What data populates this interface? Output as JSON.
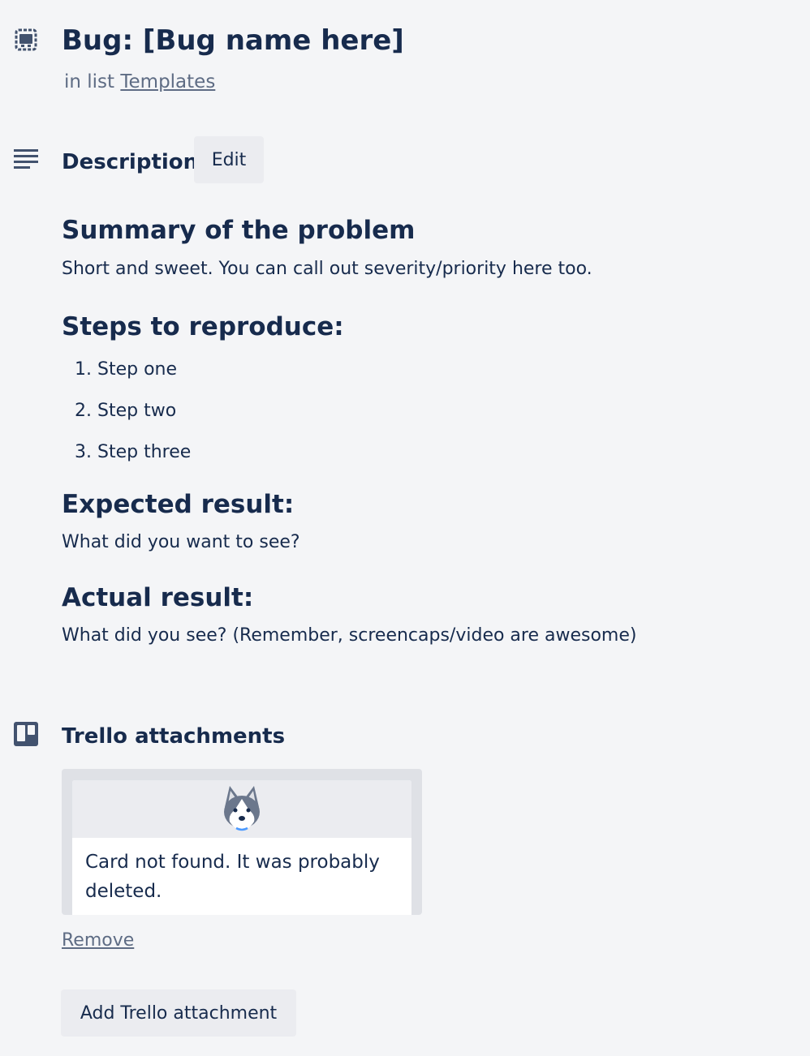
{
  "card": {
    "title": "Bug: [Bug name here]",
    "in_list_prefix": "in list",
    "list_name": "Templates"
  },
  "description": {
    "title": "Description",
    "edit_label": "Edit",
    "summary_heading": "Summary of the problem",
    "summary_text": "Short and sweet. You can call out severity/priority here too.",
    "steps_heading": "Steps to reproduce:",
    "steps": [
      "Step one",
      "Step two",
      "Step three"
    ],
    "expected_heading": "Expected result:",
    "expected_text": "What did you want to see?",
    "actual_heading": "Actual result:",
    "actual_text": "What did you see? (Remember, screencaps/video are awesome)"
  },
  "attachments": {
    "title": "Trello attachments",
    "not_found_text": "Card not found. It was probably deleted.",
    "remove_label": "Remove",
    "add_label": "Add Trello attachment"
  },
  "icons": {
    "card": "card-icon",
    "description": "description-icon",
    "trello": "trello-board-icon",
    "husky": "husky-mascot-icon"
  },
  "colors": {
    "background": "#f4f5f7",
    "text": "#172b4d",
    "muted": "#5e6c84",
    "button": "#ebecf0"
  }
}
